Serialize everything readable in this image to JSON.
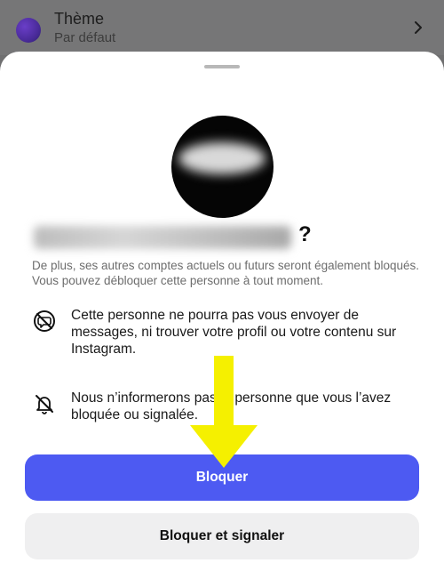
{
  "background_row": {
    "title": "Thème",
    "subtitle": "Par défaut",
    "icons": [
      "theme-color-dot",
      "chevron-right-icon"
    ]
  },
  "sheet": {
    "headline_suffix": "?",
    "description": "De plus, ses autres comptes actuels ou futurs seront également bloqués. Vous pouvez débloquer cette personne à tout moment.",
    "items": [
      {
        "icon": "block-message-icon",
        "text": "Cette personne ne pourra pas vous envoyer de messages, ni trouver votre profil ou votre contenu sur Instagram."
      },
      {
        "icon": "bell-off-icon",
        "text": "Nous n’informerons pas la personne que vous l’avez bloquée ou signalée."
      }
    ],
    "primary_button": "Bloquer",
    "secondary_button": "Bloquer et signaler"
  },
  "colors": {
    "primary": "#4d5af2",
    "annotation_arrow": "#f5f000"
  }
}
